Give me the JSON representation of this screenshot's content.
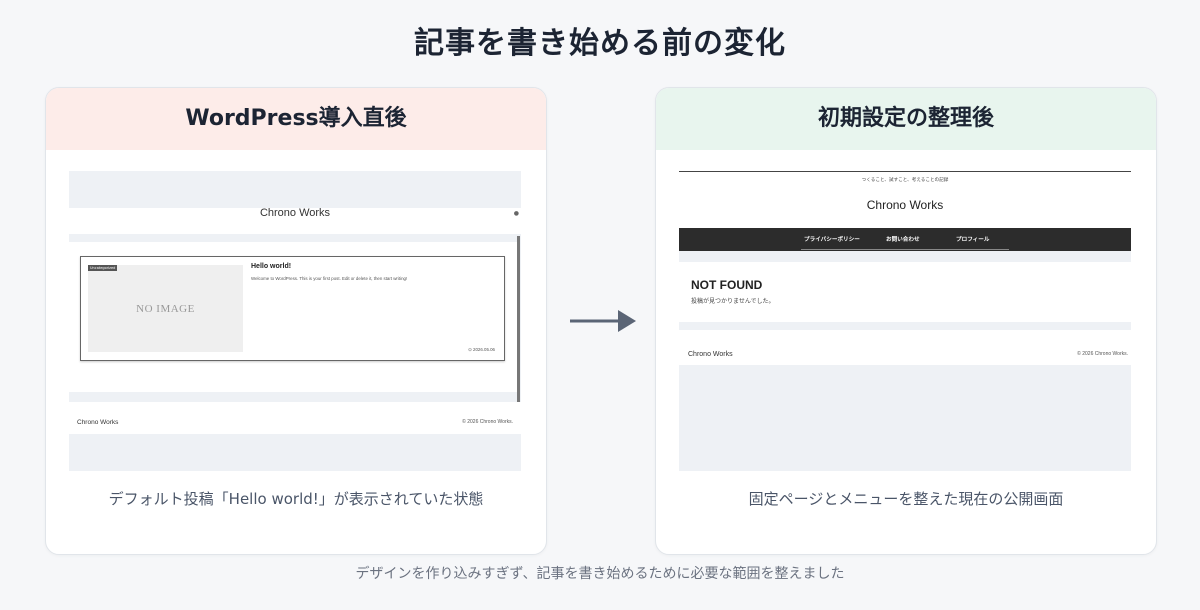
{
  "title": "記事を書き始める前の変化",
  "left_card": {
    "header": "WordPress導入直後",
    "caption": "デフォルト投稿「Hello world!」が表示されていた状態",
    "screenshot": {
      "site_title": "Chrono Works",
      "badge": "Uncategorized",
      "no_image": "NO IMAGE",
      "post_title": "Hello world!",
      "excerpt": "Welcome to WordPress. This is your first post. Edit or delete it, then start writing!",
      "date": "2026.05.06",
      "footer_left": "Chrono Works",
      "footer_right": "© 2026 Chrono Works."
    }
  },
  "right_card": {
    "header": "初期設定の整理後",
    "caption": "固定ページとメニューを整えた現在の公開画面",
    "screenshot": {
      "tagline": "つくること、試すこと、考えることの記録",
      "site_title": "Chrono Works",
      "nav": [
        "プライバシーポリシー",
        "お問い合わせ",
        "プロフィール"
      ],
      "not_found_title": "NOT FOUND",
      "not_found_text": "投稿が見つかりませんでした。",
      "footer_left": "Chrono Works",
      "footer_right": "© 2026 Chrono Works."
    }
  },
  "footnote": "デザインを作り込みすぎず、記事を書き始めるために必要な範囲を整えました",
  "colors": {
    "left_header_bg": "#fdece9",
    "right_header_bg": "#e8f5ee",
    "arrow": "#5b6576",
    "nav_bg": "#2c2c2c"
  }
}
